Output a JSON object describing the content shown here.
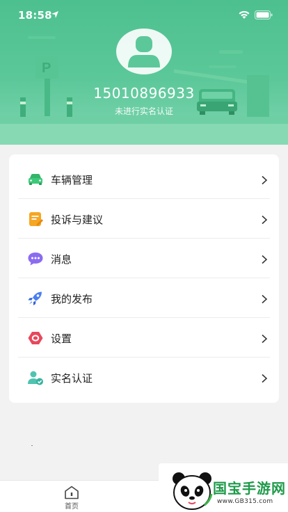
{
  "status_bar": {
    "time": "18:58"
  },
  "profile": {
    "phone": "15010896933",
    "verify_status": "未进行实名认证"
  },
  "menu": {
    "items": [
      {
        "label": "车辆管理",
        "icon": "car-icon"
      },
      {
        "label": "投诉与建议",
        "icon": "feedback-icon"
      },
      {
        "label": "消息",
        "icon": "message-icon"
      },
      {
        "label": "我的发布",
        "icon": "rocket-icon"
      },
      {
        "label": "设置",
        "icon": "settings-icon"
      },
      {
        "label": "实名认证",
        "icon": "verified-user-icon"
      }
    ]
  },
  "tab_bar": {
    "home_label": "首页"
  },
  "watermark": {
    "title": "国宝手游网",
    "url": "www.GB315.com"
  },
  "colors": {
    "brand_green": "#5cc89a",
    "accent_red": "#e8475b",
    "accent_blue": "#4a7ff0"
  }
}
